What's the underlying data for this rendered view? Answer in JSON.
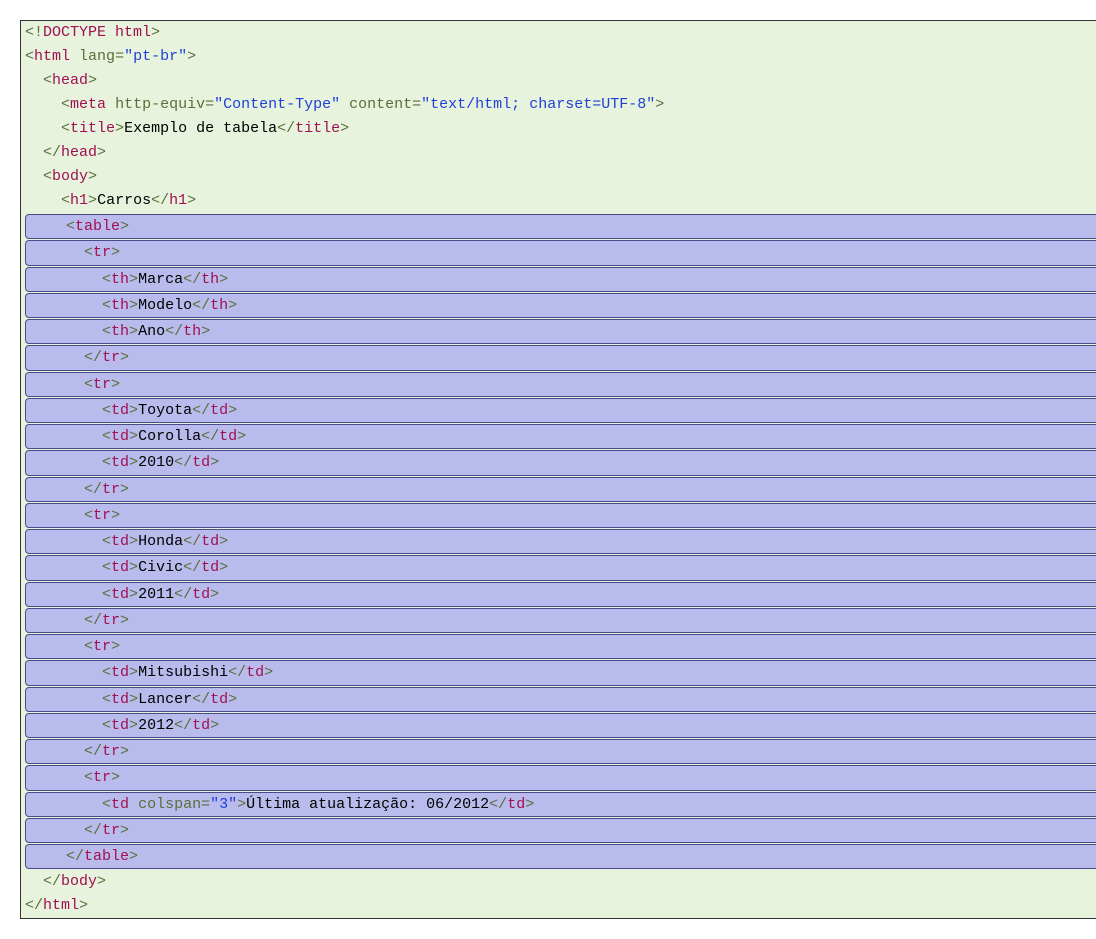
{
  "doctype": "<!DOCTYPE html>",
  "html_open": {
    "tag": "html",
    "attr": "lang",
    "val": "\"pt-br\""
  },
  "head_open": "head",
  "meta": {
    "tag": "meta",
    "attr1": "http-equiv",
    "val1": "\"Content-Type\"",
    "attr2": "content",
    "val2": "\"text/html; charset=UTF-8\""
  },
  "title": {
    "tag": "title",
    "text": "Exemplo de tabela"
  },
  "head_close": "head",
  "body_open": "body",
  "h1": {
    "tag": "h1",
    "text": "Carros"
  },
  "table_open": "table",
  "tr": "tr",
  "th": "th",
  "td": "td",
  "headers": [
    "Marca",
    "Modelo",
    "Ano"
  ],
  "rows": [
    [
      "Toyota",
      "Corolla",
      "2010"
    ],
    [
      "Honda",
      "Civic",
      "2011"
    ],
    [
      "Mitsubishi",
      "Lancer",
      "2012"
    ]
  ],
  "footer": {
    "attr": "colspan",
    "val": "\"3\"",
    "text": "Última atualização: 06/2012"
  },
  "table_close": "table",
  "body_close": "body",
  "html_close": "html"
}
